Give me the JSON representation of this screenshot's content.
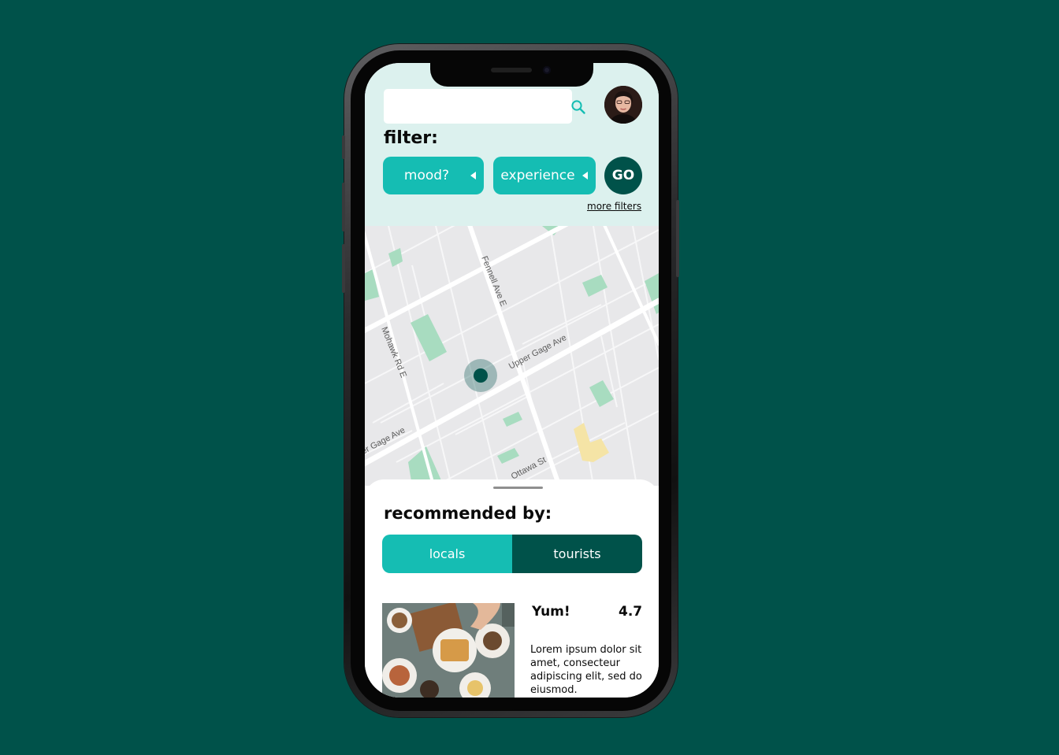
{
  "colors": {
    "background": "#00524a",
    "accent": "#15bdb3",
    "dark": "#00524a",
    "header_bg": "#dcf1ee",
    "park": "#a8dcc0"
  },
  "header": {
    "search": {
      "placeholder": "",
      "value": "",
      "icon": "search-icon"
    },
    "avatar": "avatar",
    "filter_title": "filter:",
    "filters": [
      {
        "label": "mood?",
        "icon": "caret-left-icon"
      },
      {
        "label": "experience",
        "icon": "caret-left-icon"
      }
    ],
    "go_label": "GO",
    "more_filters": "more filters"
  },
  "map": {
    "streets": [
      "Fennell Ave E",
      "Mohawk Rd E",
      "Upper Gage Ave",
      "er Gage Ave",
      "Ottawa St"
    ],
    "location_marker": "location-pin-icon"
  },
  "sheet": {
    "title": "recommended by:",
    "segments": [
      {
        "label": "locals",
        "active": true
      },
      {
        "label": "tourists",
        "active": false
      }
    ],
    "card": {
      "name": "Yum!",
      "rating": "4.7",
      "description": "Lorem ipsum dolor sit amet, consecteur adipiscing elit, sed do eiusmod."
    }
  }
}
